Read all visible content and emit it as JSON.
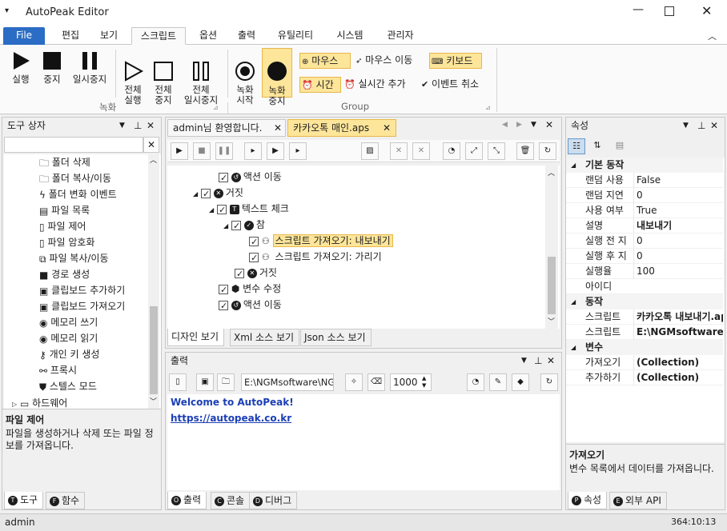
{
  "app": {
    "title": "AutoPeak Editor"
  },
  "menu_tabs": [
    "File",
    "편집",
    "보기",
    "스크립트",
    "옵션",
    "출력",
    "유틸리티",
    "시스템",
    "관리자"
  ],
  "ribbon": {
    "run": "실행",
    "stop": "중지",
    "pause": "일시중지",
    "run_all": "전체\n실행",
    "stop_all": "전체\n중지",
    "pause_all": "전체\n일시중지",
    "record_start": "녹화\n시작",
    "record_stop": "녹화\n중지",
    "mouse": "마우스",
    "mouse_move": "마우스 이동",
    "keyboard": "키보드",
    "time": "시간",
    "realtime_add": "실시간 추가",
    "event_cancel": "이벤트 취소",
    "group_record": "녹화",
    "group_group": "Group"
  },
  "toolbox": {
    "title": "도구 상자",
    "items": [
      "폴더 삭제",
      "폴더 복사/이동",
      "폴더 변화 이벤트",
      "파일 목록",
      "파일 제어",
      "파일 암호화",
      "파일 복사/이동",
      "경로 생성",
      "클립보드 추가하기",
      "클립보드 가져오기",
      "메모리 쓰기",
      "메모리 읽기",
      "개인 키 생성",
      "프록시",
      "스텔스 모드",
      "하드웨어"
    ],
    "desc_title": "파일 제어",
    "desc_text": "파일을 생성하거나 삭제 또는 파일 정보를 가져옵니다.",
    "tabs": [
      "도구",
      "함수"
    ]
  },
  "editor": {
    "tabs": [
      "admin님 환영합니다.",
      "카카오톡 매인.aps"
    ],
    "tree": [
      {
        "label": "액션 이동",
        "indent": 0
      },
      {
        "label": "거짓",
        "indent": -1
      },
      {
        "label": "텍스트 체크",
        "indent": 0
      },
      {
        "label": "참",
        "indent": 1
      },
      {
        "label": "스크립트 가져오기: 내보내기",
        "indent": 2
      },
      {
        "label": "스크립트 가져오기: 가리기",
        "indent": 2
      },
      {
        "label": "거짓",
        "indent": 1
      },
      {
        "label": "변수 수정",
        "indent": 0
      },
      {
        "label": "액션 이동",
        "indent": 0
      }
    ],
    "view_tabs": [
      "디자인 보기",
      "Xml 소스 보기",
      "Json 소스 보기"
    ]
  },
  "output": {
    "title": "출력",
    "path": "E:\\NGMsoftware\\NG",
    "spin_value": "1000",
    "welcome": "Welcome to AutoPeak!",
    "link": "https://autopeak.co.kr",
    "tabs": [
      "출력",
      "콘솔",
      "디버그"
    ]
  },
  "properties": {
    "title": "속성",
    "cat_basic": "기본 동작",
    "rows_basic": [
      {
        "name": "랜덤 사용",
        "value": "False"
      },
      {
        "name": "랜덤 지연",
        "value": "0"
      },
      {
        "name": "사용 여부",
        "value": "True"
      },
      {
        "name": "설명",
        "value": "내보내기"
      },
      {
        "name": "실행 전 지",
        "value": "0"
      },
      {
        "name": "실행 후 지",
        "value": "0"
      },
      {
        "name": "실행율",
        "value": "100"
      },
      {
        "name": "아이디",
        "value": ""
      }
    ],
    "cat_action": "동작",
    "rows_action": [
      {
        "name": "스크립트",
        "value": "카카오톡 내보내기.ap"
      },
      {
        "name": "스크립트",
        "value": "E:\\NGMsoftware\\"
      }
    ],
    "cat_var": "변수",
    "rows_var": [
      {
        "name": "가져오기",
        "value": "(Collection)"
      },
      {
        "name": "추가하기",
        "value": "(Collection)"
      }
    ],
    "desc_title": "가져오기",
    "desc_text": "변수 목록에서 데이터를 가져옵니다.",
    "tabs": [
      "속성",
      "외부 API"
    ]
  },
  "status": {
    "user": "admin",
    "time": "364:10:13"
  },
  "colors": {
    "accent": "#2b6cc4",
    "highlight": "#fde59a",
    "link": "#1c3fb5"
  }
}
